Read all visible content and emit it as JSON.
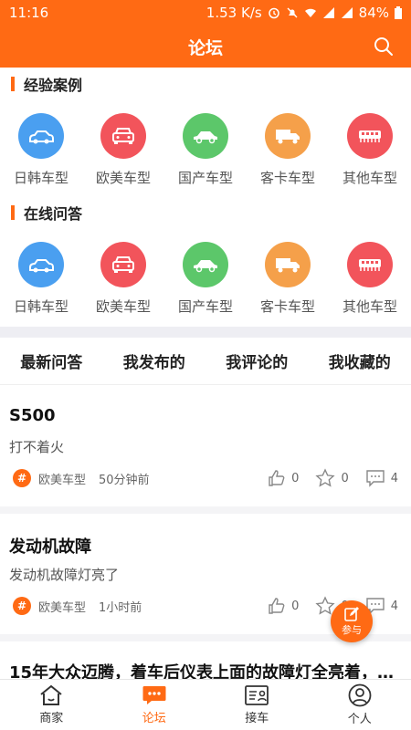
{
  "status_bar": {
    "time": "11:16",
    "speed": "1.53 K/s",
    "battery": "84%"
  },
  "header": {
    "title": "论坛",
    "search_icon": "search-icon"
  },
  "sections": [
    {
      "title": "经验案例",
      "categories": [
        {
          "label": "日韩车型",
          "color": "#4a9ff0",
          "icon": "sedan-icon"
        },
        {
          "label": "欧美车型",
          "color": "#f2545b",
          "icon": "suv-icon"
        },
        {
          "label": "国产车型",
          "color": "#5cc76a",
          "icon": "car-side-icon"
        },
        {
          "label": "客卡车型",
          "color": "#f5a04a",
          "icon": "truck-icon"
        },
        {
          "label": "其他车型",
          "color": "#f2545b",
          "icon": "train-icon"
        }
      ]
    },
    {
      "title": "在线问答",
      "categories": [
        {
          "label": "日韩车型",
          "color": "#4a9ff0",
          "icon": "sedan-icon"
        },
        {
          "label": "欧美车型",
          "color": "#f2545b",
          "icon": "suv-icon"
        },
        {
          "label": "国产车型",
          "color": "#5cc76a",
          "icon": "car-side-icon"
        },
        {
          "label": "客卡车型",
          "color": "#f5a04a",
          "icon": "truck-icon"
        },
        {
          "label": "其他车型",
          "color": "#f2545b",
          "icon": "train-icon"
        }
      ]
    }
  ],
  "tabs": [
    "最新问答",
    "我发布的",
    "我评论的",
    "我收藏的"
  ],
  "posts": [
    {
      "title": "S500",
      "desc": "打不着火",
      "category": "欧美车型",
      "time": "50分钟前",
      "likes": "0",
      "stars": "0",
      "comments": "4"
    },
    {
      "title": "发动机故障",
      "desc": "发动机故障灯亮了",
      "category": "欧美车型",
      "time": "1小时前",
      "likes": "0",
      "stars": "0",
      "comments": "4"
    },
    {
      "title": "15年大众迈腾，着车后仪表上面的故障灯全亮着，…",
      "desc": "",
      "category": "",
      "time": "",
      "likes": "",
      "stars": "",
      "comments": ""
    }
  ],
  "fab": {
    "label": "参与"
  },
  "bottom_nav": [
    {
      "label": "商家",
      "icon": "house-icon",
      "active": false
    },
    {
      "label": "论坛",
      "icon": "chat-icon",
      "active": true
    },
    {
      "label": "接车",
      "icon": "document-person-icon",
      "active": false
    },
    {
      "label": "个人",
      "icon": "person-icon",
      "active": false
    }
  ],
  "colors": {
    "accent": "#ff6a14",
    "band": "#eeeef3"
  }
}
